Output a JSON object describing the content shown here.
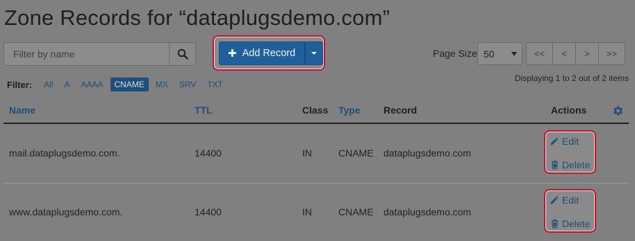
{
  "page": {
    "title": "Zone Records for “dataplugsdemo.com”"
  },
  "search": {
    "placeholder": "Filter by name",
    "icon": "search-icon"
  },
  "toolbar": {
    "add_label": "Add Record",
    "add_icon": "plus-icon",
    "dropdown_icon": "caret-down-icon"
  },
  "pagination": {
    "page_size_label": "Page Size",
    "page_size_value": "50",
    "first": "<<",
    "prev": "<",
    "next": ">",
    "last": ">>",
    "displaying": "Displaying 1 to 2 out of 2 items"
  },
  "filter": {
    "label": "Filter:",
    "options": [
      "All",
      "A",
      "AAAA",
      "CNAME",
      "MX",
      "SRV",
      "TXT"
    ],
    "active": "CNAME"
  },
  "table": {
    "columns": {
      "name": "Name",
      "ttl": "TTL",
      "class": "Class",
      "type": "Type",
      "record": "Record",
      "actions": "Actions"
    },
    "settings_icon": "gear-icon",
    "rows": [
      {
        "name": "mail.dataplugsdemo.com.",
        "ttl": "14400",
        "class": "IN",
        "type": "CNAME",
        "record": "dataplugsdemo.com",
        "edit": "Edit",
        "delete": "Delete"
      },
      {
        "name": "www.dataplugsdemo.com.",
        "ttl": "14400",
        "class": "IN",
        "type": "CNAME",
        "record": "dataplugsdemo.com",
        "edit": "Edit",
        "delete": "Delete"
      }
    ]
  },
  "colors": {
    "overlay_background": "#808080",
    "primary": "#1f5f9c",
    "link": "#1f4e79",
    "highlight_border": "#c8102e"
  }
}
